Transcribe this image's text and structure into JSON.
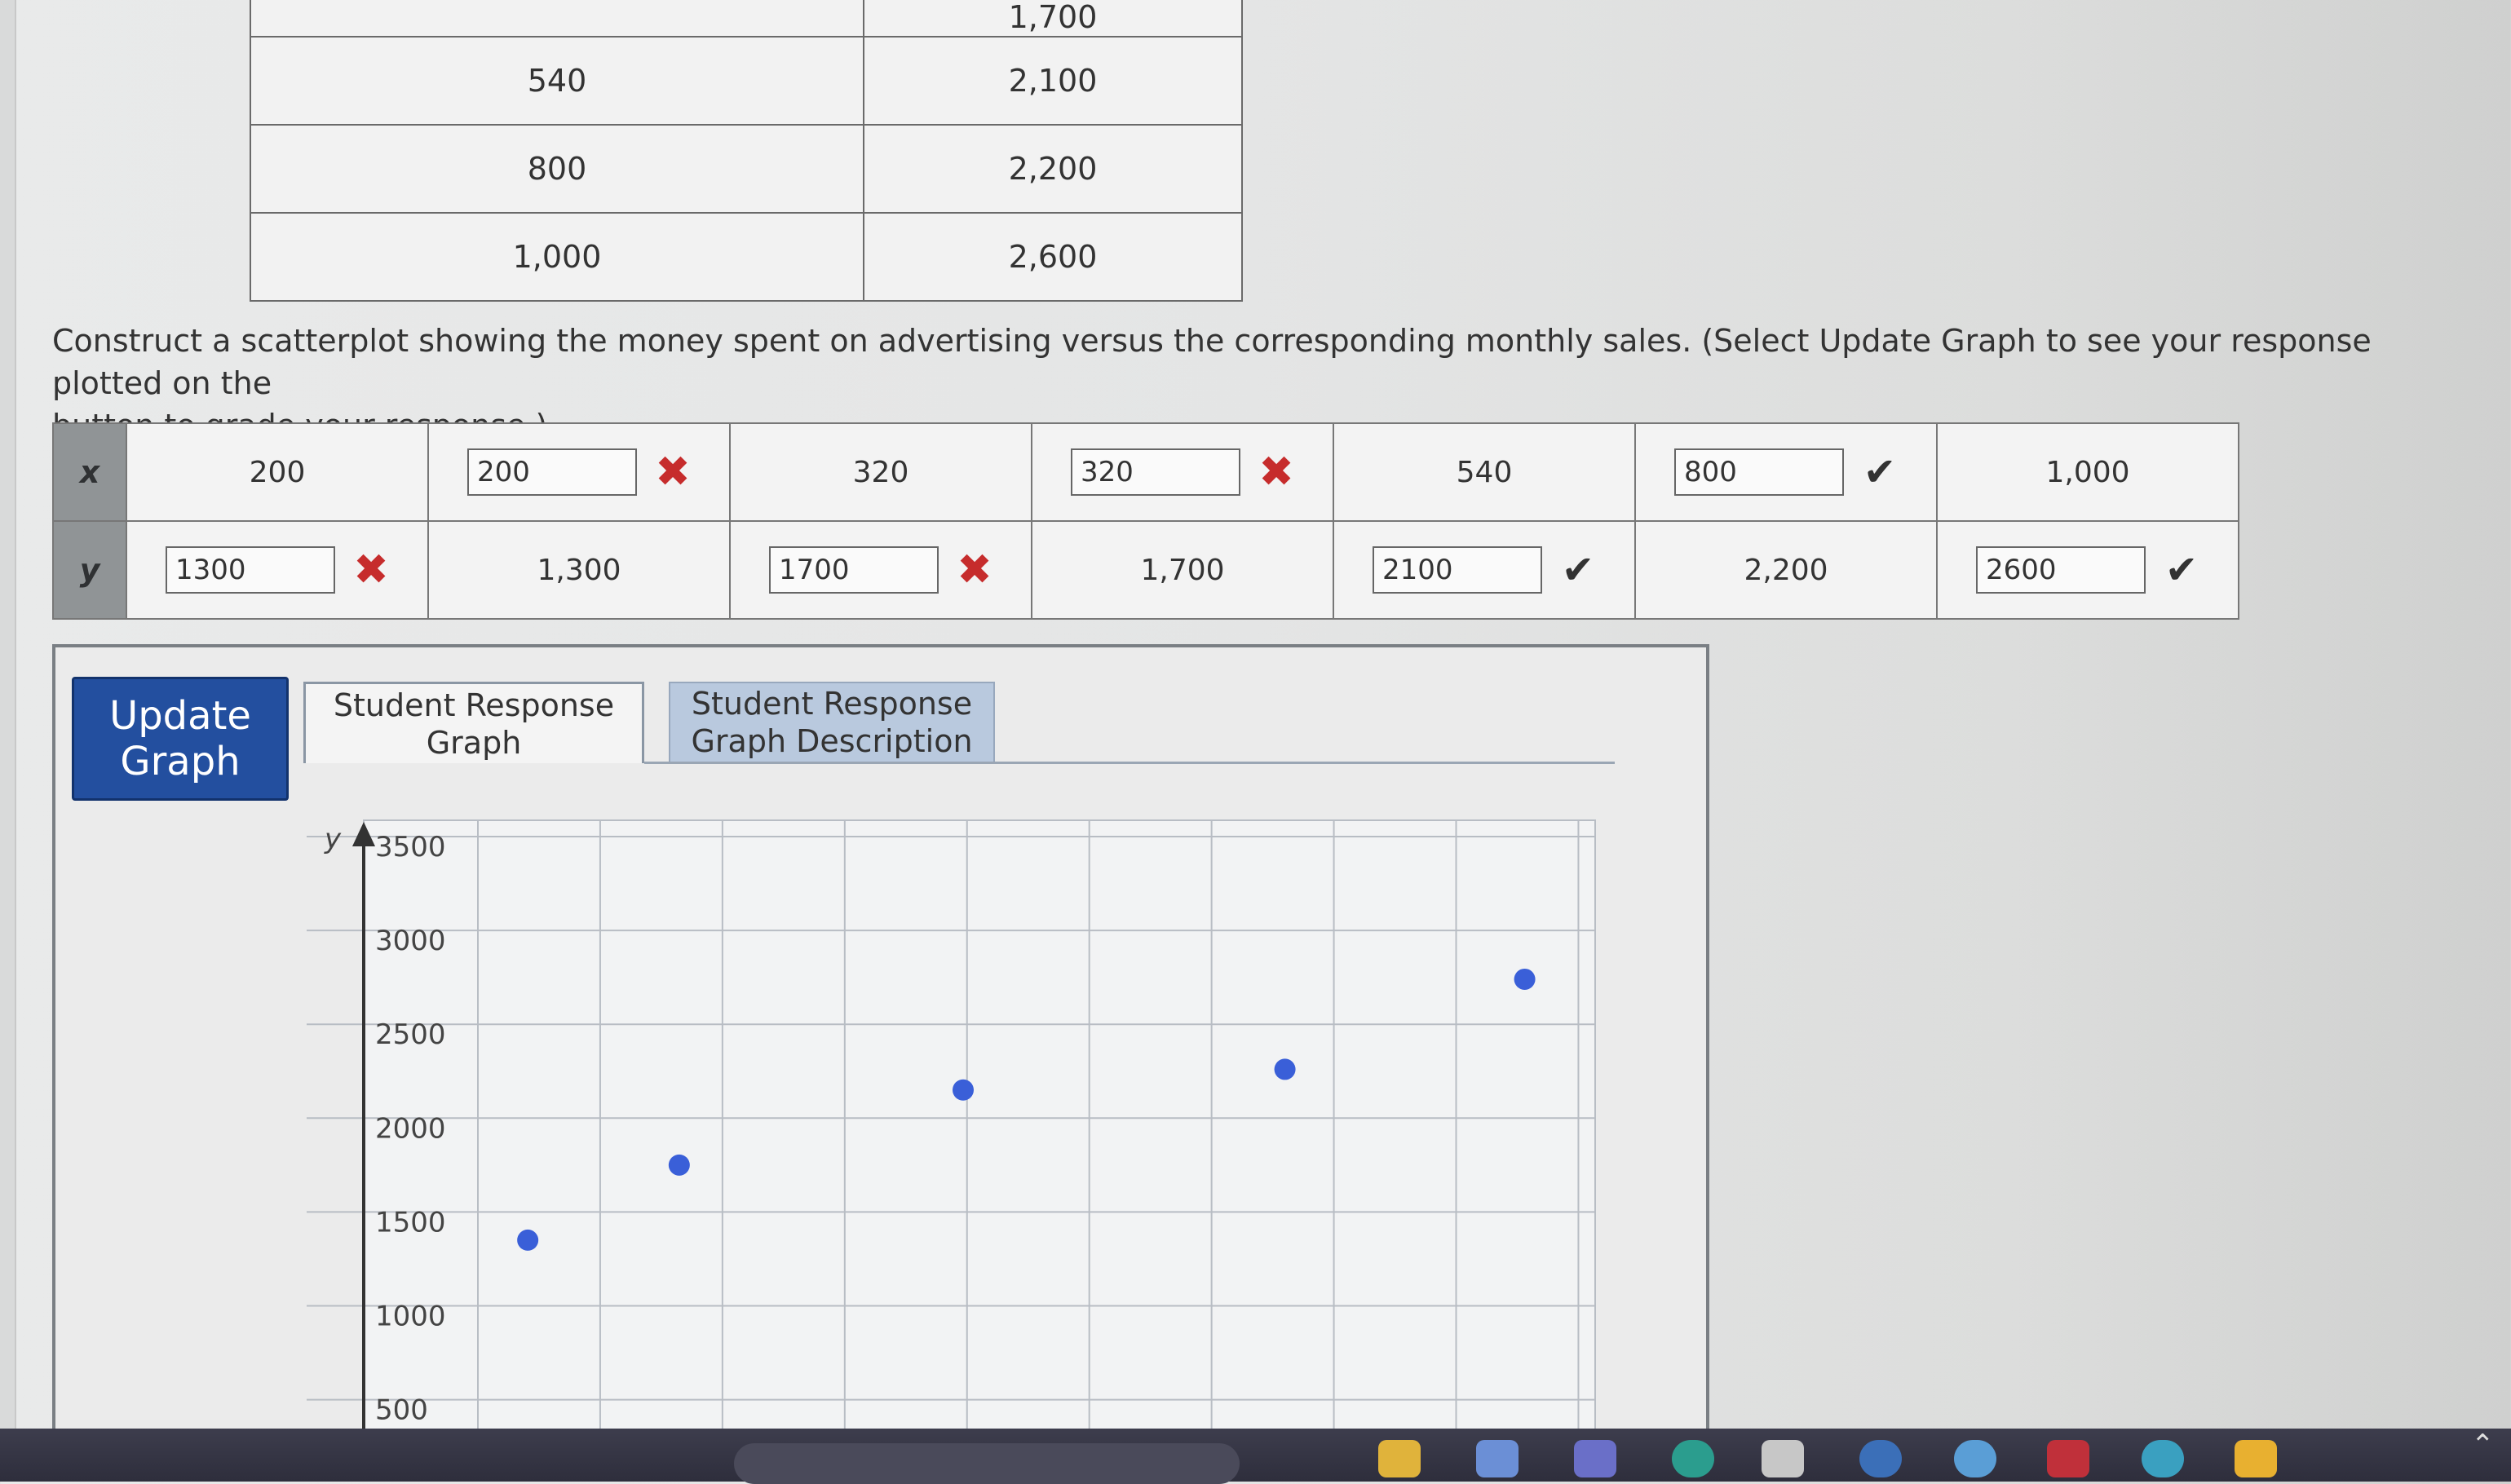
{
  "top_table": {
    "rows": [
      [
        "",
        "1,700"
      ],
      [
        "540",
        "2,100"
      ],
      [
        "800",
        "2,200"
      ],
      [
        "1,000",
        "2,600"
      ]
    ]
  },
  "instructions": {
    "line": "Construct a scatterplot showing the money spent on advertising versus the corresponding monthly sales. (Select Update Graph to see your response plotted on the",
    "line2": "button to grade your response.)"
  },
  "xy_table": {
    "x_label": "x",
    "y_label": "y",
    "x_row": [
      {
        "type": "value",
        "text": "200"
      },
      {
        "type": "input",
        "value": "200",
        "mark": "incorrect"
      },
      {
        "type": "value",
        "text": "320"
      },
      {
        "type": "input",
        "value": "320",
        "mark": "incorrect"
      },
      {
        "type": "value",
        "text": "540"
      },
      {
        "type": "input",
        "value": "800",
        "mark": "correct"
      },
      {
        "type": "value",
        "text": "1,000"
      }
    ],
    "y_row": [
      {
        "type": "input",
        "value": "1300",
        "mark": "incorrect"
      },
      {
        "type": "value",
        "text": "1,300"
      },
      {
        "type": "input",
        "value": "1700",
        "mark": "incorrect"
      },
      {
        "type": "value",
        "text": "1,700"
      },
      {
        "type": "input",
        "value": "2100",
        "mark": "correct"
      },
      {
        "type": "value",
        "text": "2,200"
      },
      {
        "type": "input",
        "value": "2600",
        "mark": "correct"
      }
    ]
  },
  "graph_panel": {
    "update_button": "Update Graph",
    "tabs": [
      "Student Response Graph",
      "Student Response Graph Description"
    ],
    "selected_tab": 0
  },
  "chart_data": {
    "type": "scatter",
    "ylabel": "y",
    "y_ticks": [
      500,
      1000,
      1500,
      2000,
      2500,
      3000,
      3500
    ],
    "ylim": [
      500,
      3500
    ],
    "xlim": [
      100,
      1050
    ],
    "grid": true,
    "point_color": "#3a5fd8",
    "points": [
      {
        "x": 230,
        "y": 1350
      },
      {
        "x": 350,
        "y": 1750
      },
      {
        "x": 575,
        "y": 2150
      },
      {
        "x": 830,
        "y": 2260
      },
      {
        "x": 1020,
        "y": 2740
      }
    ]
  },
  "colors": {
    "update_button": "#234f9f",
    "incorrect_mark": "#c62c2c",
    "correct_mark": "#333333",
    "selected_tab_inactive": "#b9c9de"
  }
}
